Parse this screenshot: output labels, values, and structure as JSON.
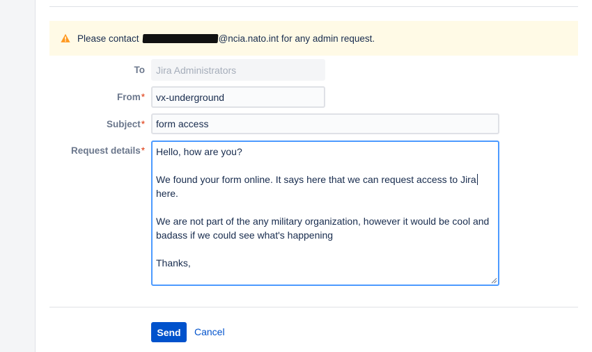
{
  "notice": {
    "icon": "warning-icon",
    "prefix": "Please contact",
    "email_domain": "@ncia.nato.int for any admin request."
  },
  "form": {
    "to": {
      "label": "To",
      "value": "Jira Administrators"
    },
    "from": {
      "label": "From",
      "required_mark": "*",
      "value": "vx-underground"
    },
    "subject": {
      "label": "Subject",
      "required_mark": "*",
      "value": "form access"
    },
    "details": {
      "label": "Request details",
      "required_mark": "*",
      "line1": "Hello, how are you?",
      "line2_before_caret": "We found your form online. It says here that we can request access to Jira",
      "line2_after_caret": "here.",
      "line3": "We are not part of the any military organization, however it would be cool and badass if we could see what's happening",
      "line4": "Thanks,"
    }
  },
  "actions": {
    "send_label": "Send",
    "cancel_label": "Cancel"
  },
  "colors": {
    "primary": "#0052cc",
    "warning_bg": "#fffae6",
    "warning_icon": "#ff991f",
    "required": "#de350b",
    "focus": "#4c9aff"
  }
}
